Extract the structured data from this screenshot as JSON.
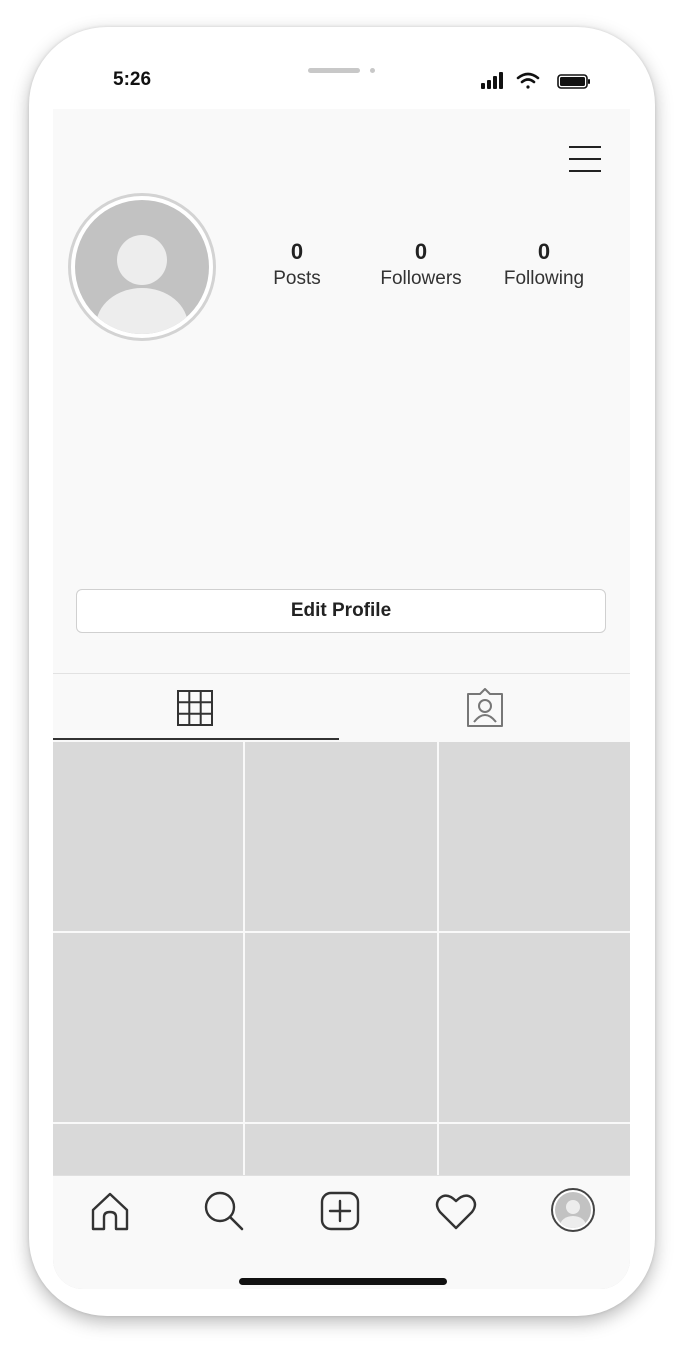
{
  "status_bar": {
    "time": "5:26",
    "signal_icon": "cellular-signal-icon",
    "wifi_icon": "wifi-icon",
    "battery_icon": "battery-icon"
  },
  "header": {
    "menu_icon": "hamburger-menu-icon"
  },
  "profile": {
    "avatar_icon": "default-avatar-icon",
    "stats": [
      {
        "value": "0",
        "label": "Posts"
      },
      {
        "value": "0",
        "label": "Followers"
      },
      {
        "value": "0",
        "label": "Following"
      }
    ],
    "edit_button_label": "Edit Profile"
  },
  "tabs": [
    {
      "icon": "grid-icon",
      "selected": true
    },
    {
      "icon": "tagged-person-icon",
      "selected": false
    }
  ],
  "posts_grid": {
    "visible_cells": 9,
    "placeholder_color": "#d9d9d9"
  },
  "bottom_nav": [
    {
      "icon": "home-icon"
    },
    {
      "icon": "search-icon"
    },
    {
      "icon": "add-post-icon"
    },
    {
      "icon": "heart-icon"
    },
    {
      "icon": "profile-avatar-icon"
    }
  ],
  "colors": {
    "screen_background": "#f9f9f9",
    "placeholder_gray": "#d9d9d9",
    "text_dark": "#222222"
  }
}
